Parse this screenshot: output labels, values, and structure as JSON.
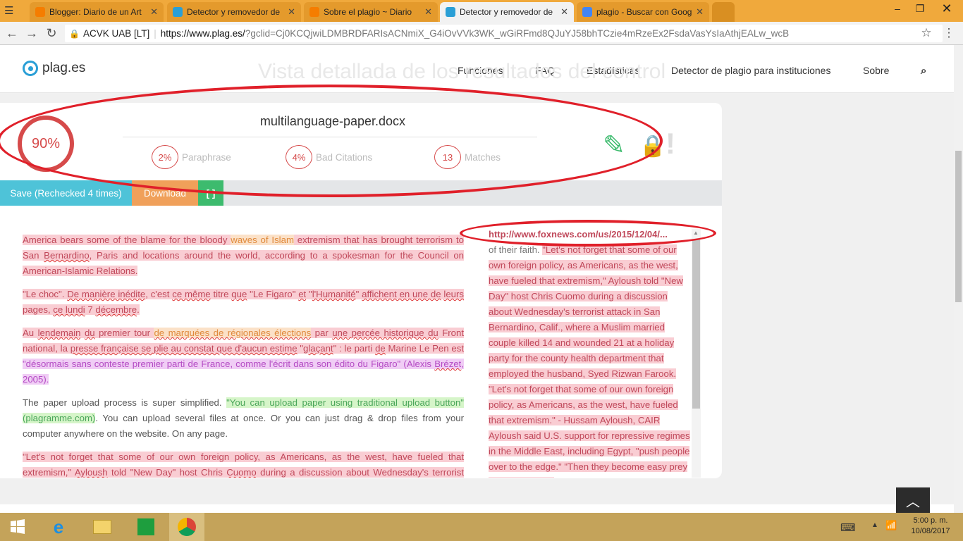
{
  "browser": {
    "tabs": [
      {
        "title": "Blogger: Diario de un Art",
        "icon": "blogger-icon",
        "color": "#f57d00",
        "active": false
      },
      {
        "title": "Detector y removedor de",
        "icon": "plag-icon",
        "color": "#2a9fd6",
        "active": false
      },
      {
        "title": "Sobre el plagio ~ Diario",
        "icon": "blogger-icon",
        "color": "#f57d00",
        "active": false
      },
      {
        "title": "Detector y removedor de",
        "icon": "plag-icon",
        "color": "#2a9fd6",
        "active": true
      },
      {
        "title": "plagio - Buscar con Goog",
        "icon": "google-icon",
        "color": "#4285f4",
        "active": false
      }
    ],
    "security_label": "ACVK UAB [LT]",
    "url_host": "https://www.plag.es/",
    "url_rest": "?gclid=Cj0KCQjwiLDMBRDFARIsACNmiX_G4iOvVVk3WK_wGiRFmd8QJuYJ58bhTCzie4mRzeEx2FsdaVasYsIaAthjEALw_wcB"
  },
  "site": {
    "logo_text": "plag.es",
    "nav": [
      "Funciones",
      "FAQ",
      "Estadísticas",
      "Detector de plagio para instituciones",
      "Sobre"
    ],
    "ghost_title": "Vista detallada de los resultados del control"
  },
  "report": {
    "score": "90%",
    "filename": "multilanguage-paper.docx",
    "stats": [
      {
        "value": "2%",
        "label": "Paraphrase"
      },
      {
        "value": "4%",
        "label": "Bad Citations"
      },
      {
        "value": "13",
        "label": "Matches"
      }
    ],
    "buttons": {
      "save": "Save (Rechecked 4 times)",
      "download": "Download",
      "expand": "[ ]"
    },
    "colors": {
      "save": "#4ec3d8",
      "download": "#f0a05a",
      "expand": "#3dbb6e",
      "score": "#d64a4a"
    }
  },
  "document": {
    "p1": [
      "America bears some of the blame for the bloody ",
      "waves of Islam",
      " extremism that has brought terrorism to San ",
      "Bernardino",
      ", Paris and locations around the world, according to a spokesman for the Council on American-Islamic Relations."
    ],
    "p2": [
      "\"Le choc\". ",
      "De manière inédite",
      ", c'est ",
      "ce même",
      " titre ",
      "que",
      " \"Le Figaro\" ",
      "et",
      " \"",
      "l'Humanité",
      "\" ",
      "affichent en une de",
      " ",
      "leurs",
      " pages, ",
      "ce lundi",
      " 7 ",
      "décembre",
      "."
    ],
    "p3": [
      "Au ",
      "lendemain",
      " ",
      "du",
      " premier tour ",
      "de marquées de régionales élections",
      " par ",
      "une percée historique du",
      " Front national, la ",
      "presse française se plie au constat que d'aucun estime",
      " \"",
      "glaçant",
      "\" : le parti ",
      "de",
      " Marine Le Pen est ",
      "\"désormais sans conteste premier parti de France, comme l'écrit dans son édito du Figaro\" (Alexis ",
      "Brézet",
      ", 2005)."
    ],
    "p4": [
      "The paper upload process is super simplified. ",
      "\"You can upload paper using traditional upload button\" (plagramme.com)",
      ". You can upload several files at once. Or you can just drag & drop files from your computer anywhere on the website. On any page."
    ],
    "p5": [
      "\"Let's not forget that some of our own foreign policy, as Americans, as the west, have fueled that extremism,\" ",
      "Ayloush",
      " told \"New Day\" host Chris ",
      "Cuomo",
      " during a discussion about Wednesday's terrorist attack in San Bernardino."
    ]
  },
  "source": {
    "url": "http://www.foxnews.com/us/2015/12/04/...",
    "text_plain": "of their faith. ",
    "text_match": "\"Let's not forget that some of our own foreign policy, as Americans, as the west, have fueled that extremism,\" Ayloush told \"New Day\" host Chris Cuomo during a discussion about Wednesday's terrorist attack in San Bernardino, Calif., where a Muslim married couple killed 14 and wounded 21 at a holiday party for the county health department that employed the husband, Syed Rizwan Farook. \"Let's not forget that some of our own foreign policy, as Americans, as the west, have fueled that extremism.\" - Hussam Ayloush, CAIR Ayloush said U.S. support for repressive regimes in the Middle East, including Egypt, \"push people over to the edge.\" \"Then they become easy prey for the criminals"
  },
  "taskbar": {
    "time": "5:00 p. m.",
    "date": "10/08/2017"
  }
}
